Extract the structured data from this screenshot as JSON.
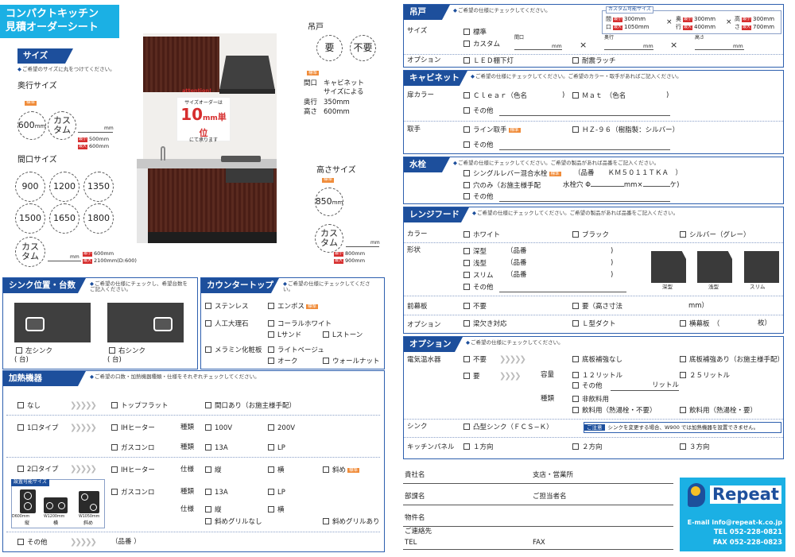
{
  "title": {
    "l1": "コンパクトキッチン",
    "l2": "見積オーダーシート"
  },
  "badges": {
    "std": "標準",
    "min": "最小",
    "max": "最大"
  },
  "size": {
    "header": "サイズ",
    "note": "ご希望のサイズに丸をつけてください。",
    "depth": {
      "label": "奥行サイズ",
      "std": "600",
      "unit": "mm",
      "custom": "カスタム",
      "min": "500mm",
      "max": "600mm"
    },
    "width": {
      "label": "間口サイズ",
      "options": [
        "900",
        "1200",
        "1350",
        "1500",
        "1650",
        "1800"
      ],
      "unit": "mm",
      "custom": "カスタム",
      "min": "600mm",
      "max": "2100mm(D:600)"
    },
    "height": {
      "label": "高さサイズ",
      "std": "850",
      "unit": "mm",
      "custom": "カスタム",
      "min": "800mm",
      "max": "900mm"
    }
  },
  "hanging": {
    "label": "吊戸",
    "yes": "要",
    "no": "不要",
    "std": "標準",
    "d1": "間口",
    "v1": "キャビネット",
    "v1b": "サイズによる",
    "d2": "奥行",
    "v2": "350mm",
    "d3": "高さ",
    "v3": "600mm"
  },
  "attention": {
    "tag": "attention!",
    "t1": "サイズオーダーは",
    "big": "10",
    "unit": "mm",
    "t2": "単位",
    "t3": "にて承ります"
  },
  "sink": {
    "header": "シンク位置・台数",
    "note": "ご希望の仕様にチェックし、希望台数を ご記入ください。",
    "left": "左シンク",
    "right": "右シンク",
    "paren": "(                台)"
  },
  "counter": {
    "header": "カウンタートップ",
    "note": "ご希望の仕様にチェックしてください。",
    "items": [
      "ステンレス",
      "エンボス",
      "人工大理石",
      "コーラルホワイト",
      "Lサンド",
      "Lストーン",
      "メラミン化粧板",
      "ライトベージュ",
      "オーク",
      "ウォールナット"
    ]
  },
  "heating": {
    "header": "加熱機器",
    "note": "ご希望の口数・加熱機器種類・仕様をそれぞれチェックしてください。",
    "none": "なし",
    "one": "1口タイプ",
    "two": "2口タイプ",
    "other": "その他",
    "flat": "トップフラット",
    "gap": "間口あり（お施主様手配）",
    "ih": "IHヒーター",
    "gas": "ガスコンロ",
    "kind": "種類",
    "spec": "仕様",
    "v100": "100V",
    "v200": "200V",
    "g13": "13A",
    "lp": "LP",
    "tate": "縦",
    "yoko": "横",
    "naname": "斜め",
    "nogrill": "斜めグリルなし",
    "withgrill": "斜めグリルあり",
    "hinban": "（品番                                                    ）",
    "sizehdr": "設置可能サイズ",
    "s1": "D600mm",
    "s2": "W1200mm",
    "s3": "W1050mm",
    "t1": "縦",
    "t2": "横",
    "t3": "斜め"
  },
  "r_hang": {
    "header": "吊戸",
    "note": "ご希望の仕様にチェックしてください。",
    "size": "サイズ",
    "std": "標準",
    "custom": "カスタム",
    "maguchi": "間口",
    "okuyuki": "奥行",
    "takasa": "高さ",
    "mm": "mm",
    "option": "オプション",
    "led": "ＬＥＤ棚下灯",
    "latch": "耐震ラッチ",
    "ctitle": "カスタム可能サイズ",
    "c_ma": "間",
    "c_mb": "口",
    "c_oa": "奥",
    "c_ob": "行",
    "c_ta": "高",
    "c_tb": "さ",
    "c1a": "300mm",
    "c1b": "1050mm",
    "c2a": "300mm",
    "c2b": "400mm",
    "c3a": "300mm",
    "c3b": "700mm"
  },
  "r_cab": {
    "header": "キャビネット",
    "note": "ご希望の仕様にチェックしてください。ご希望のカラー・取手があればご記入ください。",
    "door": "扉カラー",
    "clear": "Ｃｌｅａｒ（色名",
    "mat": "Ｍａｔ　（色名",
    "close": ")",
    "other": "その他",
    "handle": "取手",
    "line": "ライン取手",
    "hz": "ＨＺ-９６（樹脂製：シルバー）"
  },
  "r_faucet": {
    "header": "水栓",
    "note": "ご希望の仕様にチェックしてください。ご希望の製品があれば品番をご記入ください。",
    "single": "シングルレバー混合水栓",
    "hin": "（品番　　ＫＭ５０１１ＴＫＡ　）",
    "hole": "穴のみ（お施主様手配",
    "hole2": "水栓穴 Φ",
    "mmx": "mm×",
    "ke": "ケ)",
    "other": "その他"
  },
  "r_hood": {
    "header": "レンジフード",
    "note": "ご希望の仕様にチェックしてください。ご希望の製品があれば品番をご記入ください。",
    "color": "カラー",
    "white": "ホワイト",
    "black": "ブラック",
    "silver": "シルバー（グレー）",
    "shape": "形状",
    "deep": "深型",
    "shallow": "浅型",
    "slim": "スリム",
    "other": "その他",
    "hin": "（品番",
    "close": ")",
    "front": "前幕板",
    "no": "不要",
    "yes": "要（高さ寸法",
    "mm": "mm）",
    "option": "オプション",
    "cut": "梁欠き対応",
    "duct": "Ｌ型ダクト",
    "yoko": "横幕板　（",
    "mai": "枚）",
    "img1": "深型",
    "img2": "浅型",
    "img3": "スリム"
  },
  "r_opt": {
    "header": "オプション",
    "note": "ご希望の仕様にチェックしてください。",
    "heater": "電気温水器",
    "no": "不要",
    "yes": "要",
    "capacity": "容量",
    "type": "種類",
    "reinf_no": "底板補強なし",
    "reinf_yes": "底板補強あり（お施主様手配）",
    "l12": "１２リットル",
    "l25": "２５リットル",
    "lother": "その他",
    "liter": "リットル",
    "nondrink": "非飲料用",
    "drink": "飲料用（熱湯栓・不要）",
    "drink2": "飲料用（熱湯栓・要）",
    "sink": "シンク",
    "sinkopt": "凸型シンク（ＦＣＳ−Ｋ）",
    "caution": "ご注意",
    "caution_text": "シンクを変更する場合、W900 では加熱機器を設置できません。",
    "panel": "キッチンパネル",
    "d1": "１方向",
    "d2": "２方向",
    "d3": "３方向"
  },
  "footer": {
    "company": "貴社名",
    "branch": "支店・営業所",
    "dept": "部課名",
    "person": "ご担当者名",
    "property": "物件名",
    "contact": "ご連絡先",
    "tel": "TEL",
    "fax": "FAX"
  },
  "logo": {
    "name": "Repeat",
    "email": "E-mail info@repeat-k.co.jp",
    "tel": "TEL 052-228-0821",
    "fax": "FAX 052-228-0823"
  },
  "colors": {
    "navy": "#1d4f9c",
    "cyan": "#1bb0e4",
    "orange": "#f08c3a",
    "red": "#d62d2d",
    "wood": "#4a1e16"
  }
}
